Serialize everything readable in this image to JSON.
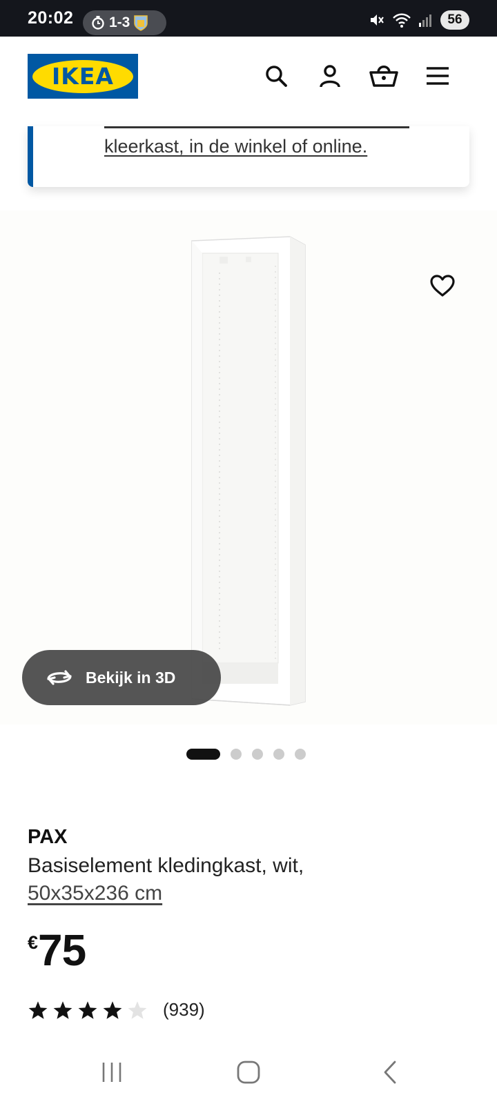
{
  "status_bar": {
    "time": "20:02",
    "score": "1-3",
    "battery": "56"
  },
  "header": {
    "logo_text": "IKEA",
    "icons": [
      "search-icon",
      "account-icon",
      "basket-icon",
      "menu-icon"
    ]
  },
  "notice": {
    "text": "kleerkast, in de winkel of online."
  },
  "gallery": {
    "view_3d_label": "Bekijk in 3D",
    "slide_count": 5,
    "active_slide": 1
  },
  "product": {
    "brand": "PAX",
    "description": "Basiselement kledingkast, wit,",
    "size": "50x35x236 cm",
    "currency": "€",
    "price": "75",
    "rating": 4,
    "rating_max": 5,
    "review_count": "(939)"
  },
  "colors": {
    "ikea_blue": "#0058a3",
    "ikea_yellow": "#ffdb00",
    "status_bar_bg": "#14161c"
  }
}
